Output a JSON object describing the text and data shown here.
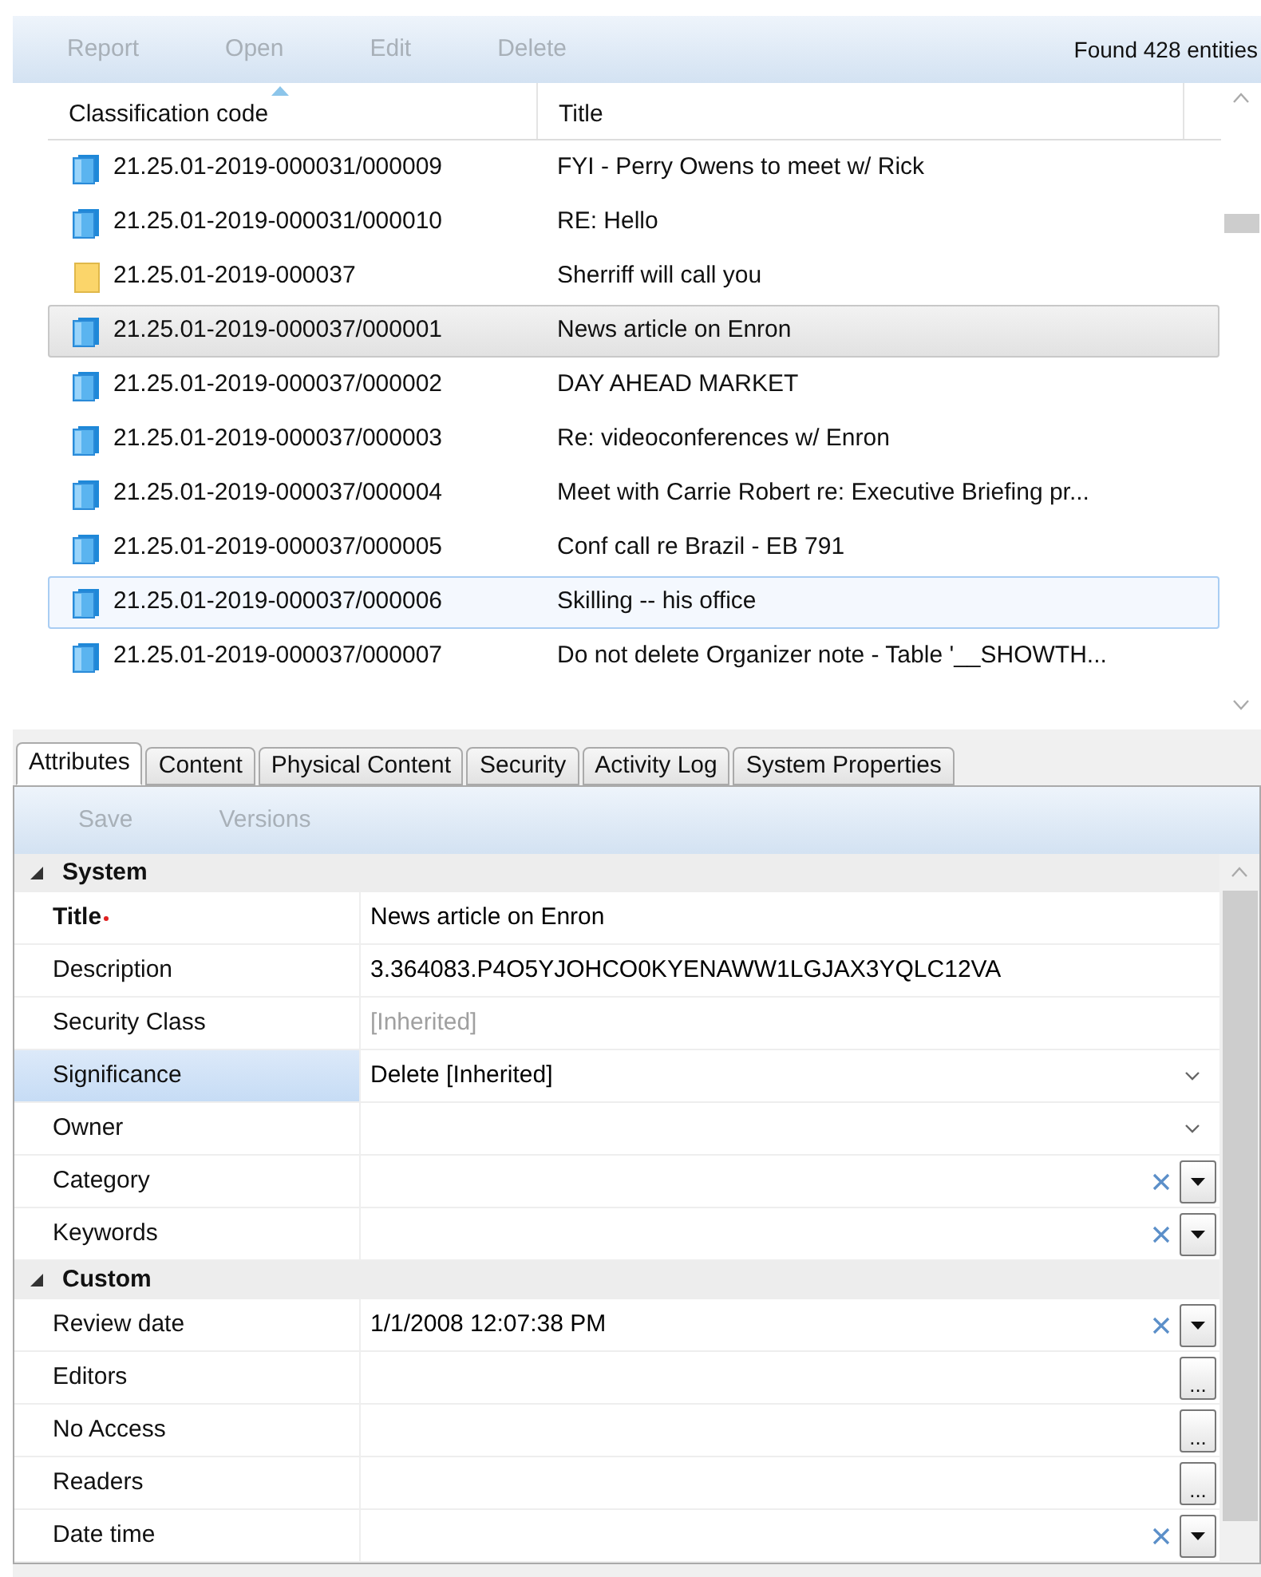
{
  "toolbar": {
    "buttons": [
      {
        "label": "Report",
        "disabled": true
      },
      {
        "label": "Open",
        "disabled": true
      },
      {
        "label": "Edit",
        "disabled": true
      },
      {
        "label": "Delete",
        "disabled": true
      }
    ],
    "status": "Found 428 entities"
  },
  "table": {
    "columns": [
      {
        "label": "Classification code",
        "sorted": true
      },
      {
        "label": "Title",
        "sorted": false
      }
    ],
    "rows": [
      {
        "kind": "document",
        "code": "21.25.01-2019-000031/000009",
        "title": "FYI - Perry Owens to meet w/ Rick",
        "selected": false,
        "hovered": false
      },
      {
        "kind": "document",
        "code": "21.25.01-2019-000031/000010",
        "title": "RE: Hello",
        "selected": false,
        "hovered": false
      },
      {
        "kind": "folder",
        "code": "21.25.01-2019-000037",
        "title": "Sherriff will call you",
        "selected": false,
        "hovered": false
      },
      {
        "kind": "document",
        "code": "21.25.01-2019-000037/000001",
        "title": "News article on Enron",
        "selected": true,
        "hovered": false
      },
      {
        "kind": "document",
        "code": "21.25.01-2019-000037/000002",
        "title": "DAY AHEAD MARKET",
        "selected": false,
        "hovered": false
      },
      {
        "kind": "document",
        "code": "21.25.01-2019-000037/000003",
        "title": "Re: videoconferences w/ Enron",
        "selected": false,
        "hovered": false
      },
      {
        "kind": "document",
        "code": "21.25.01-2019-000037/000004",
        "title": "Meet with Carrie Robert re:  Executive Briefing pr...",
        "selected": false,
        "hovered": false
      },
      {
        "kind": "document",
        "code": "21.25.01-2019-000037/000005",
        "title": "Conf call re Brazil - EB 791",
        "selected": false,
        "hovered": false
      },
      {
        "kind": "document",
        "code": "21.25.01-2019-000037/000006",
        "title": "Skilling -- his office",
        "selected": false,
        "hovered": true
      },
      {
        "kind": "document",
        "code": "21.25.01-2019-000037/000007",
        "title": "Do not delete Organizer note - Table '__SHOWTH...",
        "selected": false,
        "hovered": false
      }
    ]
  },
  "tabs": [
    {
      "label": "Attributes",
      "selected": true
    },
    {
      "label": "Content",
      "selected": false
    },
    {
      "label": "Physical Content",
      "selected": false
    },
    {
      "label": "Security",
      "selected": false
    },
    {
      "label": "Activity Log",
      "selected": false
    },
    {
      "label": "System Properties",
      "selected": false
    }
  ],
  "detail_toolbar": {
    "buttons": [
      {
        "label": "Save",
        "disabled": true
      },
      {
        "label": "Versions",
        "disabled": true
      }
    ]
  },
  "groups": [
    {
      "label": "System",
      "expanded": true,
      "properties": [
        {
          "kind": "text",
          "label": "Title",
          "required": true,
          "value": "News article on Enron",
          "muted": false,
          "selected": false
        },
        {
          "kind": "text",
          "label": "Description",
          "required": false,
          "value": "3.364083.P4O5YJOHCO0KYENAWW1LGJAX3YQLC12VA",
          "muted": false,
          "selected": false
        },
        {
          "kind": "text",
          "label": "Security Class",
          "required": false,
          "value": "[Inherited]",
          "muted": true,
          "selected": false
        },
        {
          "kind": "dropdown",
          "label": "Significance",
          "required": false,
          "value": "Delete [Inherited]",
          "muted": false,
          "selected": true
        },
        {
          "kind": "dropdown",
          "label": "Owner",
          "required": false,
          "selected": false
        },
        {
          "kind": "combo",
          "label": "Category",
          "required": false,
          "selected": false
        },
        {
          "kind": "combo",
          "label": "Keywords",
          "required": false,
          "selected": false
        }
      ]
    },
    {
      "label": "Custom",
      "expanded": true,
      "properties": [
        {
          "kind": "combo",
          "label": "Review date",
          "required": false,
          "value": "1/1/2008 12:07:38 PM",
          "muted": false,
          "selected": false
        },
        {
          "kind": "ellipsis",
          "label": "Editors",
          "required": false,
          "button": "...",
          "selected": false
        },
        {
          "kind": "ellipsis",
          "label": "No Access",
          "required": false,
          "button": "...",
          "selected": false
        },
        {
          "kind": "ellipsis",
          "label": "Readers",
          "required": false,
          "button": "...",
          "selected": false
        },
        {
          "kind": "combo",
          "label": "Date time",
          "required": false,
          "selected": false
        }
      ]
    }
  ]
}
